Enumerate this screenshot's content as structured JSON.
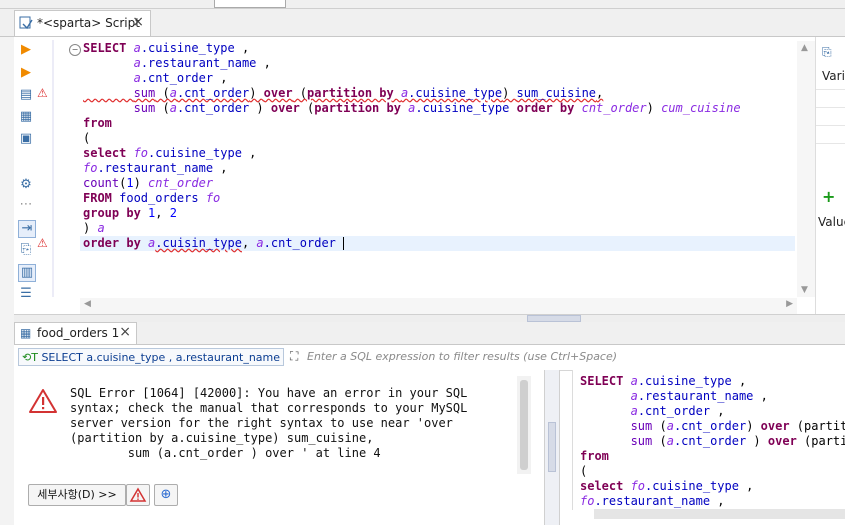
{
  "editor": {
    "tab_title": "*<sparta> Script",
    "code_lines": [
      [
        [
          "kw",
          "SELECT "
        ],
        [
          "al",
          "a"
        ],
        [
          "id",
          ".cuisine_type"
        ],
        [
          "pl",
          " ,"
        ]
      ],
      [
        [
          "pl",
          "       "
        ],
        [
          "al",
          "a"
        ],
        [
          "id",
          ".restaurant_name"
        ],
        [
          "pl",
          " ,"
        ]
      ],
      [
        [
          "pl",
          "       "
        ],
        [
          "al",
          "a"
        ],
        [
          "id",
          ".cnt_order"
        ],
        [
          "pl",
          " ,"
        ]
      ],
      [
        [
          "pl",
          "       "
        ],
        [
          "fn",
          "sum"
        ],
        [
          "pl",
          " ("
        ],
        [
          "al",
          "a"
        ],
        [
          "id",
          ".cnt_order"
        ],
        [
          "pl",
          ") "
        ],
        [
          "kw",
          "over"
        ],
        [
          "pl",
          " ("
        ],
        [
          "kw",
          "partition by "
        ],
        [
          "al",
          "a"
        ],
        [
          "id",
          ".cuisine_type"
        ],
        [
          "pl",
          ") "
        ],
        [
          "id",
          "sum_cuisine"
        ],
        [
          "pl",
          ","
        ]
      ],
      [
        [
          "pl",
          "       "
        ],
        [
          "fn",
          "sum"
        ],
        [
          "pl",
          " ("
        ],
        [
          "al",
          "a"
        ],
        [
          "id",
          ".cnt_order"
        ],
        [
          "pl",
          " ) "
        ],
        [
          "kw",
          "over"
        ],
        [
          "pl",
          " ("
        ],
        [
          "kw",
          "partition by "
        ],
        [
          "al",
          "a"
        ],
        [
          "id",
          ".cuisine_type "
        ],
        [
          "kw",
          "order by "
        ],
        [
          "al",
          "cnt_order"
        ],
        [
          "pl",
          ") "
        ],
        [
          "al",
          "cum_cuisine"
        ]
      ],
      [
        [
          "kw",
          "from"
        ]
      ],
      [
        [
          "pl",
          "("
        ]
      ],
      [
        [
          "kw",
          "select "
        ],
        [
          "al",
          "fo"
        ],
        [
          "id",
          ".cuisine_type"
        ],
        [
          "pl",
          " ,"
        ]
      ],
      [
        [
          "al",
          "fo"
        ],
        [
          "id",
          ".restaurant_name"
        ],
        [
          "pl",
          " ,"
        ]
      ],
      [
        [
          "fn",
          "count"
        ],
        [
          "pl",
          "("
        ],
        [
          "num",
          "1"
        ],
        [
          "pl",
          ") "
        ],
        [
          "al",
          "cnt_order"
        ]
      ],
      [
        [
          "kw",
          "FROM "
        ],
        [
          "id",
          "food_orders "
        ],
        [
          "al",
          "fo"
        ]
      ],
      [
        [
          "kw",
          "group by "
        ],
        [
          "num",
          "1"
        ],
        [
          "pl",
          ", "
        ],
        [
          "num",
          "2"
        ]
      ],
      [
        [
          "pl",
          ") "
        ],
        [
          "al",
          "a"
        ]
      ],
      [
        [
          "kw",
          "order by "
        ],
        [
          "al",
          "a"
        ],
        [
          "id",
          ".cuisin_type"
        ],
        [
          "pl",
          ", "
        ],
        [
          "al",
          "a"
        ],
        [
          "id",
          ".cnt_order"
        ],
        [
          "pl",
          " "
        ]
      ]
    ]
  },
  "right_panel": {
    "variables_label": "Vari",
    "value_label": "Value"
  },
  "results": {
    "tab_title": "food_orders 1",
    "filter_query": "SELECT a.cuisine_type , a.restaurant_name , a.",
    "filter_placeholder": "Enter a SQL expression to filter results (use Ctrl+Space)",
    "error_message": "SQL Error [1064] [42000]: You have an error in your SQL\nsyntax; check the manual that corresponds to your MySQL\nserver version for the right syntax to use near 'over\n(partition by a.cuisine_type) sum_cuisine,\n        sum (a.cnt_order ) over ' at line 4",
    "details_button": "세부사항(D) >>"
  },
  "preview": {
    "code_lines": [
      [
        [
          "kw",
          "SELECT "
        ],
        [
          "al",
          "a"
        ],
        [
          "id",
          ".cuisine_type"
        ],
        [
          "pl",
          " ,"
        ]
      ],
      [
        [
          "pl",
          "       "
        ],
        [
          "al",
          "a"
        ],
        [
          "id",
          ".restaurant_name"
        ],
        [
          "pl",
          " ,"
        ]
      ],
      [
        [
          "pl",
          "       "
        ],
        [
          "al",
          "a"
        ],
        [
          "id",
          ".cnt_order"
        ],
        [
          "pl",
          " ,"
        ]
      ],
      [
        [
          "pl",
          "       "
        ],
        [
          "fn",
          "sum"
        ],
        [
          "pl",
          " ("
        ],
        [
          "al",
          "a"
        ],
        [
          "id",
          ".cnt_order"
        ],
        [
          "pl",
          ") "
        ],
        [
          "kw",
          "over"
        ],
        [
          "pl",
          " (partiti"
        ]
      ],
      [
        [
          "pl",
          "       "
        ],
        [
          "fn",
          "sum"
        ],
        [
          "pl",
          " ("
        ],
        [
          "al",
          "a"
        ],
        [
          "id",
          ".cnt_order"
        ],
        [
          "pl",
          " ) "
        ],
        [
          "kw",
          "over"
        ],
        [
          "pl",
          " (partit"
        ]
      ],
      [
        [
          "kw",
          "from"
        ]
      ],
      [
        [
          "pl",
          "("
        ]
      ],
      [
        [
          "kw",
          "select "
        ],
        [
          "al",
          "fo"
        ],
        [
          "id",
          ".cuisine_type"
        ],
        [
          "pl",
          " ,"
        ]
      ],
      [
        [
          "al",
          "fo"
        ],
        [
          "id",
          ".restaurant_name"
        ],
        [
          "pl",
          " ,"
        ]
      ]
    ]
  },
  "colors": {
    "keyword": "#7f0055",
    "alias": "#8a2be2",
    "error": "#d33333",
    "current_line": "#e8f2fe"
  }
}
